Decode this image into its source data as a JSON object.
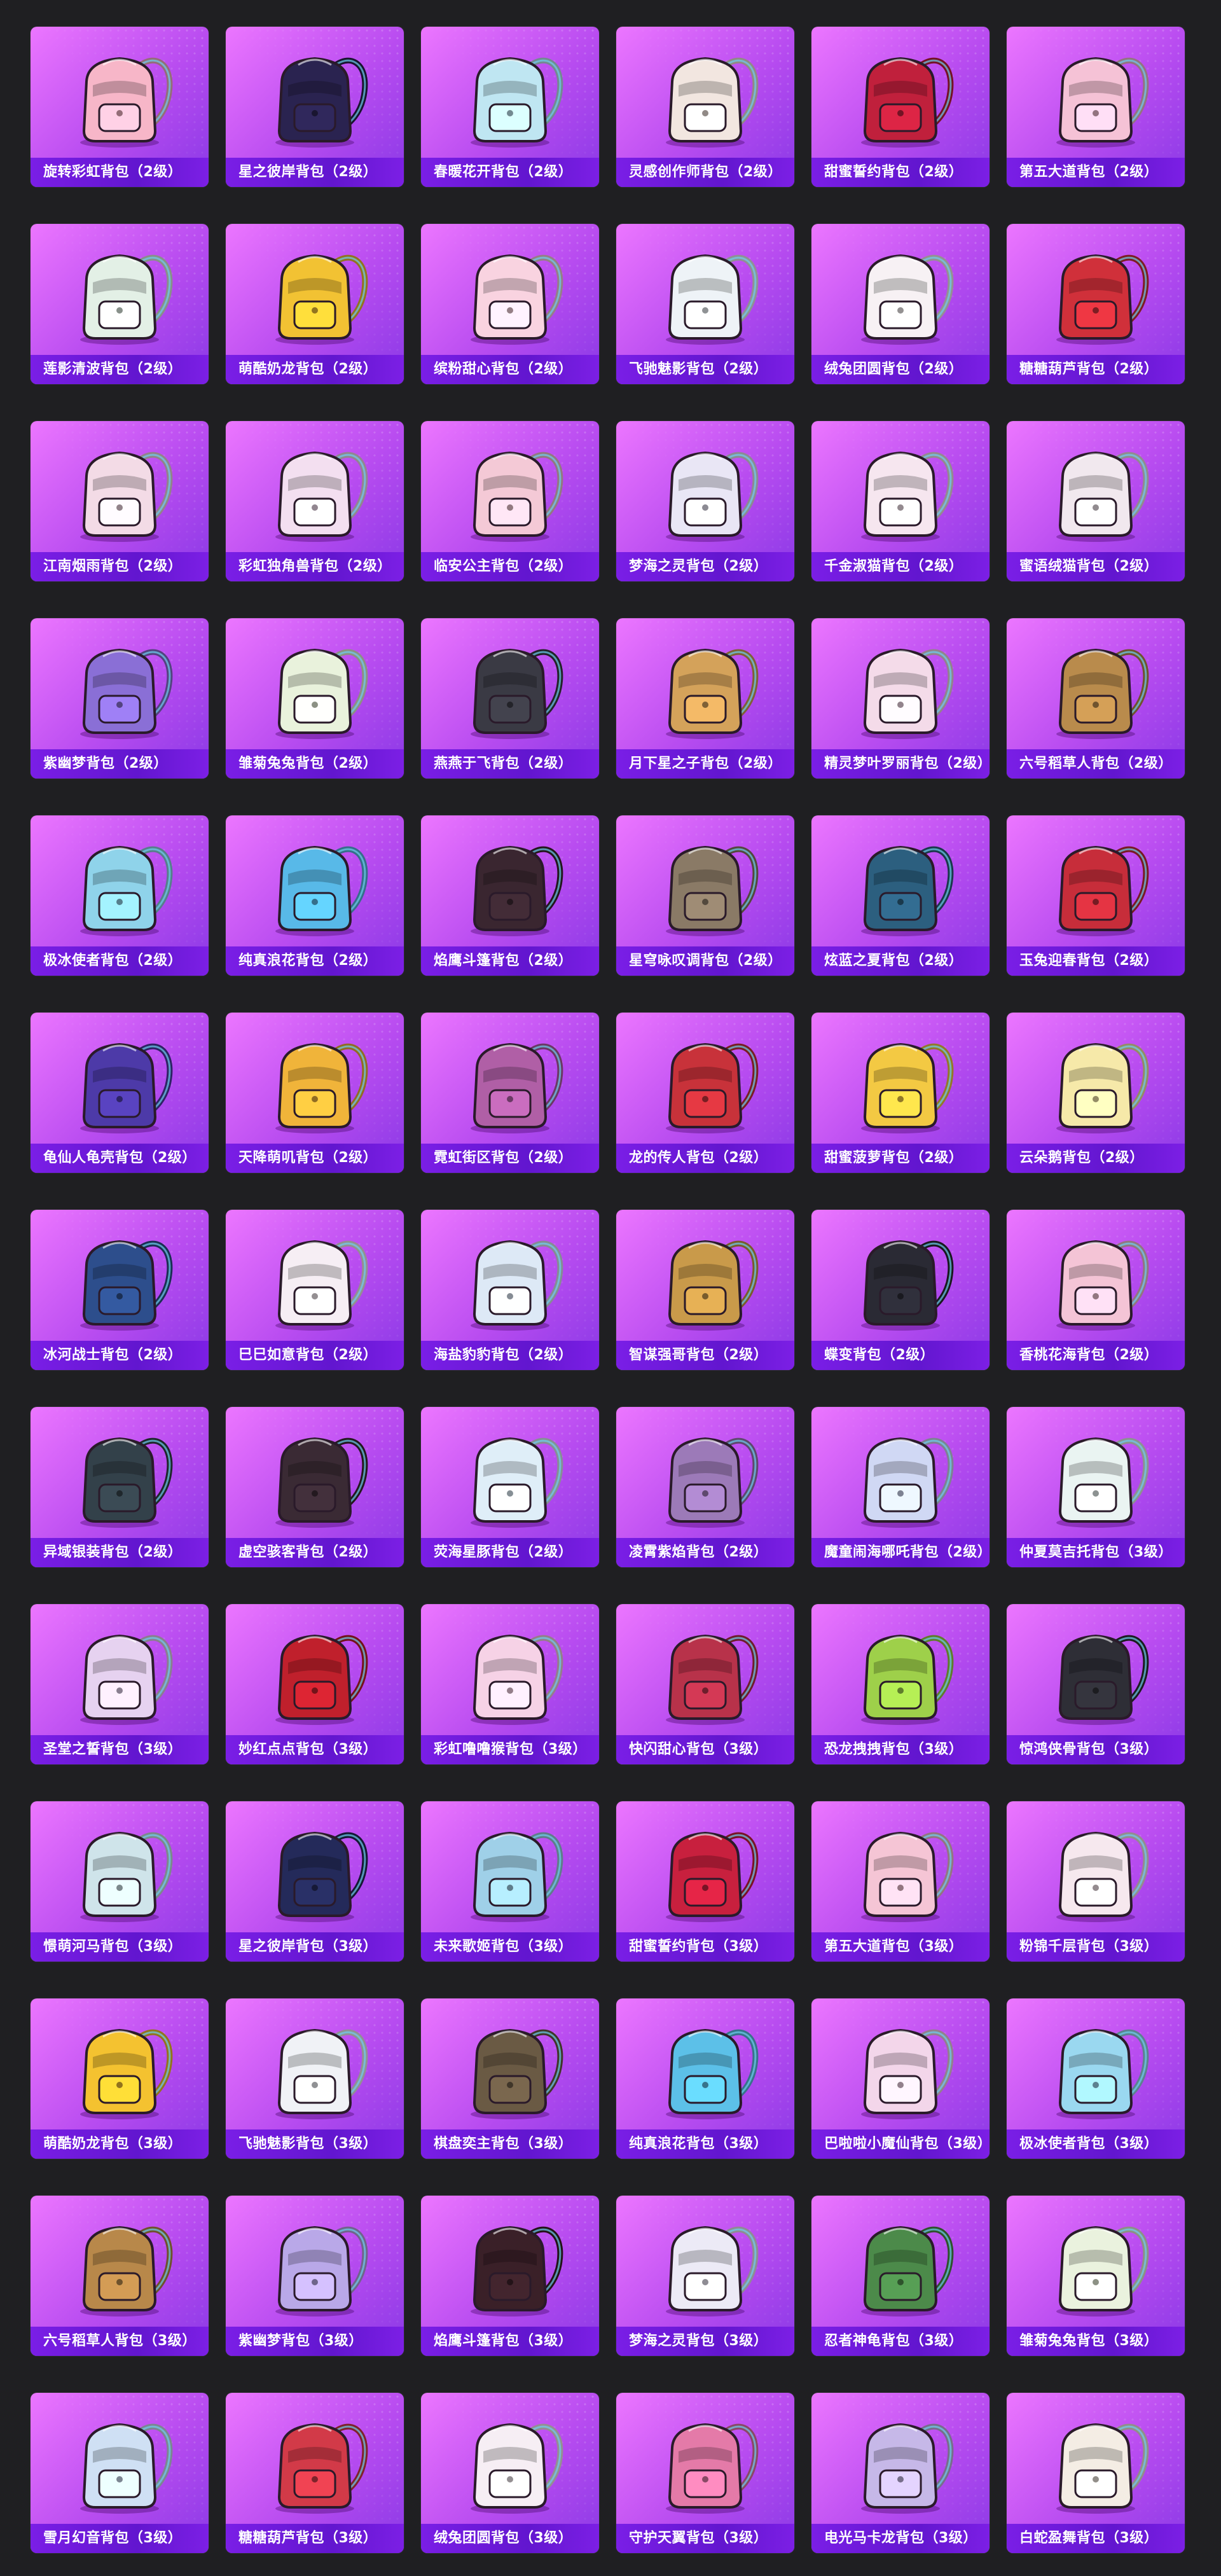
{
  "colors": {
    "page_background": "#1f1f22",
    "card_gradient_start": "#ec76ff",
    "card_gradient_end": "#8a39e6",
    "label_bar": "#6216cf",
    "label_text": "#ffffff"
  },
  "icon": "backpack-icon",
  "items": [
    {
      "name": "旋转彩虹背包（2级）",
      "color": "#f7b6c8"
    },
    {
      "name": "星之彼岸背包（2级）",
      "color": "#2a2350"
    },
    {
      "name": "春暖花开背包（2级）",
      "color": "#bfe6f2"
    },
    {
      "name": "灵感创作师背包（2级）",
      "color": "#f2e6e0"
    },
    {
      "name": "甜蜜誓约背包（2级）",
      "color": "#c0203c"
    },
    {
      "name": "第五大道背包（2级）",
      "color": "#f5c2d6"
    },
    {
      "name": "莲影清波背包（2级）",
      "color": "#e3f0e6"
    },
    {
      "name": "萌酷奶龙背包（2级）",
      "color": "#f2c233"
    },
    {
      "name": "缤粉甜心背包（2级）",
      "color": "#f9d3e0"
    },
    {
      "name": "飞驰魅影背包（2级）",
      "color": "#eef3f7"
    },
    {
      "name": "绒兔团圆背包（2级）",
      "color": "#f7f1f4"
    },
    {
      "name": "糖糖葫芦背包（2级）",
      "color": "#d0303a"
    },
    {
      "name": "江南烟雨背包（2级）",
      "color": "#f3dbe6"
    },
    {
      "name": "彩虹独角兽背包（2级）",
      "color": "#f3dff0"
    },
    {
      "name": "临安公主背包（2级）",
      "color": "#f4c9d6"
    },
    {
      "name": "梦海之灵背包（2级）",
      "color": "#e9e6f5"
    },
    {
      "name": "千金淑猫背包（2级）",
      "color": "#f6e6ef"
    },
    {
      "name": "蜜语绒猫背包（2级）",
      "color": "#f1e8ee"
    },
    {
      "name": "紫幽梦背包（2级）",
      "color": "#8a6fd6"
    },
    {
      "name": "雏菊兔兔背包（2级）",
      "color": "#e9f2dc"
    },
    {
      "name": "燕燕于飞背包（2级）",
      "color": "#3a3a44"
    },
    {
      "name": "月下星之子背包（2级）",
      "color": "#d4a25a"
    },
    {
      "name": "精灵梦叶罗丽背包（2级）",
      "color": "#f4dbe9"
    },
    {
      "name": "六号稻草人背包（2级）",
      "color": "#b98b4c"
    },
    {
      "name": "极冰使者背包（2级）",
      "color": "#8fd3ea"
    },
    {
      "name": "纯真浪花背包（2级）",
      "color": "#58b9e8"
    },
    {
      "name": "焰鹰斗篷背包（2级）",
      "color": "#3a2630"
    },
    {
      "name": "星穹咏叹调背包（2级）",
      "color": "#8a7a66"
    },
    {
      "name": "炫蓝之夏背包（2级）",
      "color": "#2c5f7f"
    },
    {
      "name": "玉兔迎春背包（2级）",
      "color": "#c72d3a"
    },
    {
      "name": "龟仙人龟壳背包（2级）",
      "color": "#4d3aa8"
    },
    {
      "name": "天降萌叽背包（2级）",
      "color": "#f0b43a"
    },
    {
      "name": "霓虹街区背包（2级）",
      "color": "#b05fa6"
    },
    {
      "name": "龙的传人背包（2级）",
      "color": "#c8323a"
    },
    {
      "name": "甜蜜菠萝背包（2级）",
      "color": "#f3c943"
    },
    {
      "name": "云朵鹅背包（2级）",
      "color": "#f6e9a9"
    },
    {
      "name": "冰河战士背包（2级）",
      "color": "#2d4e8c"
    },
    {
      "name": "巳巳如意背包（2级）",
      "color": "#f6eef4"
    },
    {
      "name": "海盐豹豹背包（2级）",
      "color": "#dde9f6"
    },
    {
      "name": "智谋强哥背包（2级）",
      "color": "#c99a4a"
    },
    {
      "name": "蝶变背包（2级）",
      "color": "#2a2a34"
    },
    {
      "name": "香桃花海背包（2级）",
      "color": "#f4c4d6"
    },
    {
      "name": "异域银装背包（2级）",
      "color": "#33414a"
    },
    {
      "name": "虚空骇客背包（2级）",
      "color": "#3a2a34"
    },
    {
      "name": "荧海星豚背包（2级）",
      "color": "#dfeef8"
    },
    {
      "name": "凌霄紫焰背包（2级）",
      "color": "#9c7ab8"
    },
    {
      "name": "魔童闹海哪吒背包（2级）",
      "color": "#d0d8f4"
    },
    {
      "name": "仲夏莫吉托背包（3级）",
      "color": "#eaf4f2"
    },
    {
      "name": "圣堂之誓背包（3级）",
      "color": "#e6d2f0"
    },
    {
      "name": "妙红点点背包（3级）",
      "color": "#c0202c"
    },
    {
      "name": "彩虹噜噜猴背包（3级）",
      "color": "#f6d2e6"
    },
    {
      "name": "快闪甜心背包（3级）",
      "color": "#b8324a"
    },
    {
      "name": "恐龙拽拽背包（3级）",
      "color": "#9ed04a"
    },
    {
      "name": "惊鸿侠骨背包（3级）",
      "color": "#2e2e36"
    },
    {
      "name": "憬萌河马背包（3级）",
      "color": "#cfe4ea"
    },
    {
      "name": "星之彼岸背包（3级）",
      "color": "#242a5a"
    },
    {
      "name": "未来歌姬背包（3级）",
      "color": "#9fd0e8"
    },
    {
      "name": "甜蜜誓约背包（3级）",
      "color": "#c8203e"
    },
    {
      "name": "第五大道背包（3级）",
      "color": "#f5c5d5"
    },
    {
      "name": "粉锦千层背包（3级）",
      "color": "#f6e8ee"
    },
    {
      "name": "萌酷奶龙背包（3级）",
      "color": "#f4c230"
    },
    {
      "name": "飞驰魅影背包（3级）",
      "color": "#f0f2f6"
    },
    {
      "name": "棋盘奕主背包（3级）",
      "color": "#6a5a44"
    },
    {
      "name": "纯真浪花背包（3级）",
      "color": "#5cc0e8"
    },
    {
      "name": "巴啦啦小魔仙背包（3级）",
      "color": "#f3d6ea"
    },
    {
      "name": "极冰使者背包（3级）",
      "color": "#9ad8f0"
    },
    {
      "name": "六号稻草人背包（3级）",
      "color": "#b8884a"
    },
    {
      "name": "紫幽梦背包（3级）",
      "color": "#b9a8e8"
    },
    {
      "name": "焰鹰斗篷背包（3级）",
      "color": "#3a2028"
    },
    {
      "name": "梦海之灵背包（3级）",
      "color": "#eceaf6"
    },
    {
      "name": "忍者神龟背包（3级）",
      "color": "#4c8a4a"
    },
    {
      "name": "雏菊兔兔背包（3级）",
      "color": "#eaf2de"
    },
    {
      "name": "雪月幻音背包（3级）",
      "color": "#cfe0f4"
    },
    {
      "name": "糖糖葫芦背包（3级）",
      "color": "#d23a48"
    },
    {
      "name": "绒兔团圆背包（3级）",
      "color": "#f6eef4"
    },
    {
      "name": "守护天翼背包（3级）",
      "color": "#e47aa8"
    },
    {
      "name": "电光马卡龙背包（3级）",
      "color": "#c6b8e8"
    },
    {
      "name": "白蛇盈舞背包（3级）",
      "color": "#f4ede4"
    }
  ]
}
